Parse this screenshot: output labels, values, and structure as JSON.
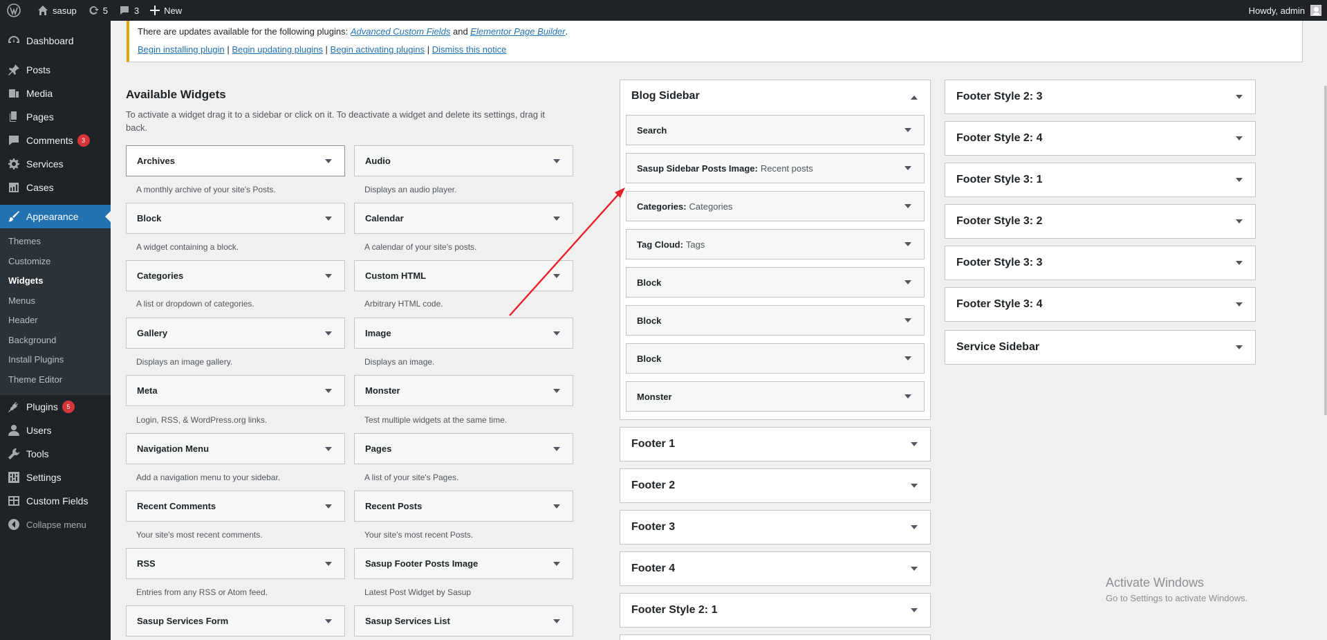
{
  "adminbar": {
    "site": "sasup",
    "updates": "5",
    "comments": "3",
    "new": "New",
    "howdy": "Howdy, admin"
  },
  "menu": {
    "dashboard": "Dashboard",
    "posts": "Posts",
    "media": "Media",
    "pages": "Pages",
    "comments": "Comments",
    "comments_badge": "3",
    "services": "Services",
    "cases": "Cases",
    "appearance": "Appearance",
    "sub": [
      "Themes",
      "Customize",
      "Widgets",
      "Menus",
      "Header",
      "Background",
      "Install Plugins",
      "Theme Editor"
    ],
    "plugins": "Plugins",
    "plugins_badge": "5",
    "users": "Users",
    "tools": "Tools",
    "settings": "Settings",
    "custom_fields": "Custom Fields",
    "collapse": "Collapse menu"
  },
  "notice": {
    "text1": "There are updates available for the following plugins: ",
    "plugin1": "Advanced Custom Fields",
    "and": " and ",
    "plugin2": "Elementor Page Builder",
    "period": ".",
    "link1": "Begin installing plugin",
    "link2": "Begin updating plugins",
    "link3": "Begin activating plugins",
    "link4": "Dismiss this notice",
    "sep": " | "
  },
  "available": {
    "title": "Available Widgets",
    "desc": "To activate a widget drag it to a sidebar or click on it. To deactivate a widget and delete its settings, drag it back.",
    "widgets": [
      {
        "name": "Archives",
        "desc": "A monthly archive of your site's Posts."
      },
      {
        "name": "Audio",
        "desc": "Displays an audio player."
      },
      {
        "name": "Block",
        "desc": "A widget containing a block."
      },
      {
        "name": "Calendar",
        "desc": "A calendar of your site's posts."
      },
      {
        "name": "Categories",
        "desc": "A list or dropdown of categories."
      },
      {
        "name": "Custom HTML",
        "desc": "Arbitrary HTML code."
      },
      {
        "name": "Gallery",
        "desc": "Displays an image gallery."
      },
      {
        "name": "Image",
        "desc": "Displays an image."
      },
      {
        "name": "Meta",
        "desc": "Login, RSS, & WordPress.org links."
      },
      {
        "name": "Monster",
        "desc": "Test multiple widgets at the same time."
      },
      {
        "name": "Navigation Menu",
        "desc": "Add a navigation menu to your sidebar."
      },
      {
        "name": "Pages",
        "desc": "A list of your site's Pages."
      },
      {
        "name": "Recent Comments",
        "desc": "Your site's most recent comments."
      },
      {
        "name": "Recent Posts",
        "desc": "Your site's most recent Posts."
      },
      {
        "name": "RSS",
        "desc": "Entries from any RSS or Atom feed."
      },
      {
        "name": "Sasup Footer Posts Image",
        "desc": "Latest Post Widget by Sasup"
      },
      {
        "name": "Sasup Services Form",
        "desc": ""
      },
      {
        "name": "Sasup Services List",
        "desc": ""
      }
    ]
  },
  "blog_sidebar": {
    "title": "Blog Sidebar",
    "widgets": [
      {
        "name": "Search",
        "sub": ""
      },
      {
        "name": "Sasup Sidebar Posts Image:",
        "sub": "Recent posts"
      },
      {
        "name": "Categories:",
        "sub": "Categories"
      },
      {
        "name": "Tag Cloud:",
        "sub": "Tags"
      },
      {
        "name": "Block",
        "sub": ""
      },
      {
        "name": "Block",
        "sub": ""
      },
      {
        "name": "Block",
        "sub": ""
      },
      {
        "name": "Monster",
        "sub": ""
      }
    ]
  },
  "mid_areas": [
    "Footer 1",
    "Footer 2",
    "Footer 3",
    "Footer 4",
    "Footer Style 2: 1"
  ],
  "right_areas": [
    "Footer Style 2: 3",
    "Footer Style 2: 4",
    "Footer Style 3: 1",
    "Footer Style 3: 2",
    "Footer Style 3: 3",
    "Footer Style 3: 4",
    "Service Sidebar"
  ],
  "activate_windows": {
    "line1": "Activate Windows",
    "line2": "Go to Settings to activate Windows."
  },
  "colors": {
    "accent": "#2271b1",
    "admin_bg": "#1d2327",
    "warning": "#dba617",
    "badge": "#d63638",
    "annotation_arrow": "#e8202a"
  }
}
